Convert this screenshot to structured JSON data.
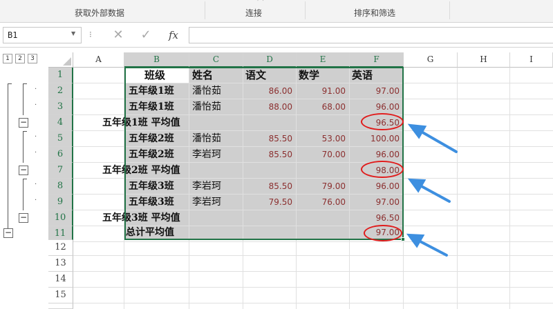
{
  "ribbon": {
    "groups": [
      {
        "id": "get-data",
        "label": "获取外部数据"
      },
      {
        "id": "connections",
        "label": "连接"
      },
      {
        "id": "sort-filter",
        "label": "排序和筛选"
      }
    ]
  },
  "formula_bar": {
    "name_box": "B1",
    "cancel_icon": "✕",
    "enter_icon": "✓",
    "fx_label": "fx",
    "formula": ""
  },
  "outline": {
    "levels": [
      "1",
      "2",
      "3"
    ],
    "collapse_symbol": "−"
  },
  "sheet": {
    "columns": [
      "A",
      "B",
      "C",
      "D",
      "E",
      "F",
      "G",
      "H",
      "I"
    ],
    "rows": [
      "1",
      "2",
      "3",
      "4",
      "5",
      "6",
      "7",
      "8",
      "9",
      "10",
      "11",
      "12",
      "13",
      "14",
      "15"
    ],
    "header": {
      "class": "班级",
      "name": "姓名",
      "chinese": "语文",
      "math": "数学",
      "english": "英语"
    },
    "data": [
      {
        "row": 2,
        "class": "五年级1班",
        "name": "潘怡茹",
        "chinese": "86.00",
        "math": "91.00",
        "english": "97.00"
      },
      {
        "row": 3,
        "class": "五年级1班",
        "name": "潘怡茹",
        "chinese": "88.00",
        "math": "68.00",
        "english": "96.00"
      },
      {
        "row": 4,
        "subtotal_label": "五年级1班 平均值",
        "english": "96.50"
      },
      {
        "row": 5,
        "class": "五年级2班",
        "name": "潘怡茹",
        "chinese": "85.50",
        "math": "53.00",
        "english": "100.00"
      },
      {
        "row": 6,
        "class": "五年级2班",
        "name": "李岩珂",
        "chinese": "85.50",
        "math": "70.00",
        "english": "96.00"
      },
      {
        "row": 7,
        "subtotal_label": "五年级2班 平均值",
        "english": "98.00"
      },
      {
        "row": 8,
        "class": "五年级3班",
        "name": "李岩珂",
        "chinese": "85.50",
        "math": "79.00",
        "english": "96.00"
      },
      {
        "row": 9,
        "class": "五年级3班",
        "name": "李岩珂",
        "chinese": "79.50",
        "math": "76.00",
        "english": "97.00"
      },
      {
        "row": 10,
        "subtotal_label": "五年级3班 平均值",
        "english": "96.50"
      },
      {
        "row": 11,
        "grand_label": "总计平均值",
        "english": "97.00"
      }
    ]
  },
  "colors": {
    "accent": "#217346",
    "selection": "#cfcfcf",
    "number_text": "#8b2f2f",
    "annotation_circle": "#e01b1b",
    "annotation_arrow": "#3d8fe0"
  }
}
